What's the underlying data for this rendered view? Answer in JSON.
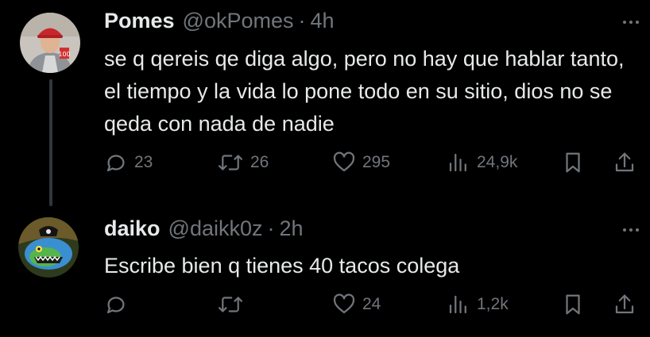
{
  "tweets": [
    {
      "name": "Pomes",
      "handle": "@okPomes",
      "separator": "·",
      "time": "4h",
      "text": "se q qereis qe diga algo, pero no hay que hablar tanto, el tiempo y la vida lo pone todo en su sitio, dios no se qeda con nada de nadie",
      "replies": "23",
      "reposts": "26",
      "likes": "295",
      "views": "24,9k"
    },
    {
      "name": "daiko",
      "handle": "@daikk0z",
      "separator": "·",
      "time": "2h",
      "text": "Escribe bien q tienes 40 tacos colega",
      "replies": "",
      "reposts": "",
      "likes": "24",
      "views": "1,2k"
    }
  ],
  "icons": {
    "reply": "reply-icon",
    "repost": "repost-icon",
    "like": "heart-icon",
    "views": "views-icon",
    "bookmark": "bookmark-icon",
    "share": "share-icon",
    "more": "more-icon"
  },
  "colors": {
    "background": "#000000",
    "text": "#e7e9ea",
    "muted": "#71767b",
    "thread_line": "#333639"
  }
}
